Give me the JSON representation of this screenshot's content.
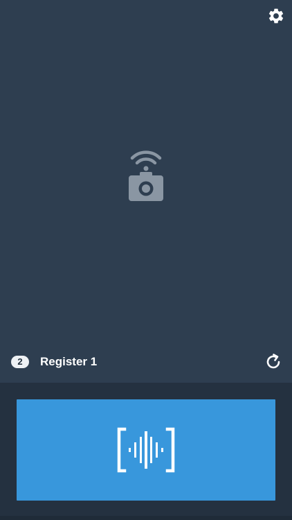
{
  "header": {
    "settings_icon": "gear-icon"
  },
  "main": {
    "placeholder_icon": "wireless-camera-icon"
  },
  "register": {
    "count": "2",
    "name": "Register 1",
    "refresh_icon": "refresh-icon"
  },
  "scan": {
    "icon": "barcode-scan-icon"
  },
  "colors": {
    "background": "#2e3e50",
    "panel": "#243140",
    "accent": "#3897dc",
    "icon_muted": "#8a96a3"
  }
}
